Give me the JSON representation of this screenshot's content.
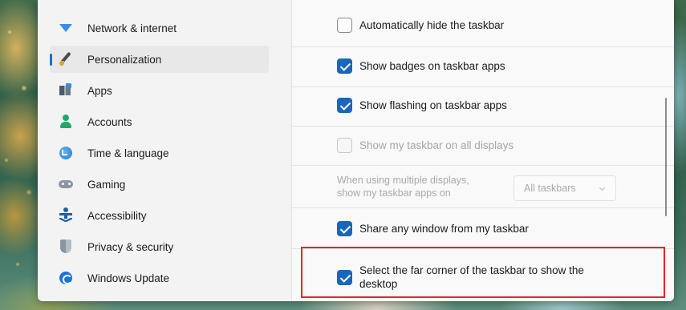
{
  "nav": {
    "items": [
      {
        "label": "Network & internet",
        "icon": "wifi-icon",
        "selected": false
      },
      {
        "label": "Personalization",
        "icon": "paintbrush-icon",
        "selected": true
      },
      {
        "label": "Apps",
        "icon": "apps-icon",
        "selected": false
      },
      {
        "label": "Accounts",
        "icon": "person-icon",
        "selected": false
      },
      {
        "label": "Time & language",
        "icon": "globe-clock-icon",
        "selected": false
      },
      {
        "label": "Gaming",
        "icon": "gamepad-icon",
        "selected": false
      },
      {
        "label": "Accessibility",
        "icon": "accessibility-icon",
        "selected": false
      },
      {
        "label": "Privacy & security",
        "icon": "shield-icon",
        "selected": false
      },
      {
        "label": "Windows Update",
        "icon": "update-icon",
        "selected": false
      }
    ]
  },
  "taskbar_behaviors": {
    "auto_hide": {
      "label": "Automatically hide the taskbar",
      "checked": false
    },
    "badges": {
      "label": "Show badges on taskbar apps",
      "checked": true
    },
    "flashing": {
      "label": "Show flashing on taskbar apps",
      "checked": true
    },
    "all_displays": {
      "label": "Show my taskbar on all displays",
      "checked": false,
      "disabled": true
    },
    "multi_display": {
      "line1": "When using multiple displays,",
      "line2": "show my taskbar apps on",
      "value": "All taskbars",
      "disabled": true
    },
    "share_window": {
      "label": "Share any window from my taskbar",
      "checked": true
    },
    "far_corner": {
      "line1": "Select the far corner of the taskbar to show the",
      "line2": "desktop",
      "checked": true
    }
  },
  "colors": {
    "accent": "#1a66b8",
    "highlight_box": "#e0262c"
  }
}
